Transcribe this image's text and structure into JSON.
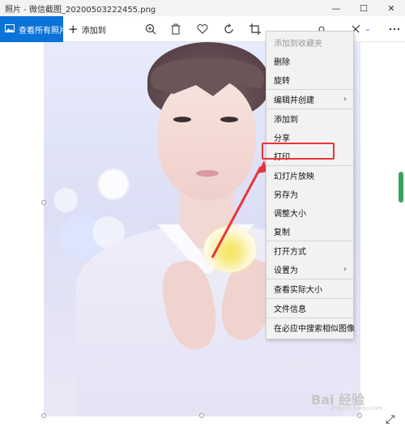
{
  "window": {
    "title": "照片 - 微信截图_20200503222455.png",
    "minimize_glyph": "—",
    "maximize_glyph": "☐",
    "close_glyph": "✕"
  },
  "toolbar": {
    "see_all_label": "查看所有照片",
    "add_to_label": "添加到"
  },
  "context_menu": {
    "groups": [
      [
        {
          "label": "添加到收藏夹",
          "disabled": true
        },
        {
          "label": "删除"
        },
        {
          "label": "旋转"
        }
      ],
      [
        {
          "label": "编辑并创建",
          "submenu": true
        }
      ],
      [
        {
          "label": "添加到"
        },
        {
          "label": "分享"
        },
        {
          "label": "打印",
          "highlighted": true
        }
      ],
      [
        {
          "label": "幻灯片放映"
        },
        {
          "label": "另存为"
        },
        {
          "label": "调整大小"
        },
        {
          "label": "复制"
        }
      ],
      [
        {
          "label": "打开方式"
        },
        {
          "label": "设置为",
          "submenu": true
        }
      ],
      [
        {
          "label": "查看实际大小"
        }
      ],
      [
        {
          "label": "文件信息"
        }
      ],
      [
        {
          "label": "在必应中搜索相似图像"
        }
      ]
    ],
    "submenu_arrow": "›"
  },
  "watermark": {
    "text": "Bai 经验",
    "sub": "jingyan.baidu.com"
  },
  "colors": {
    "accent": "#0a72d8",
    "highlight": "#e8353a",
    "arrow": "#e8353a",
    "scroll": "#3aa35c"
  }
}
